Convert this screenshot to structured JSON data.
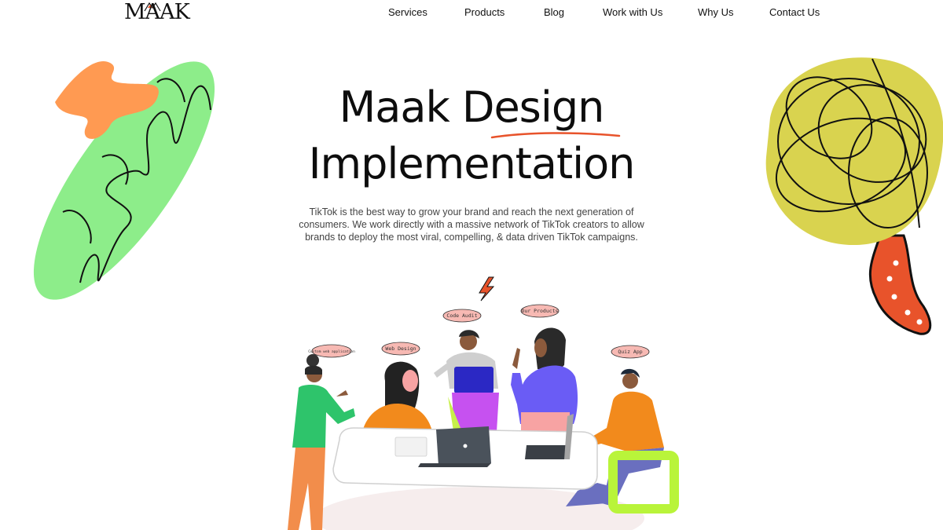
{
  "brand": {
    "logo_text": "MAAK"
  },
  "nav": {
    "items": [
      {
        "label": "Services"
      },
      {
        "label": "Products"
      },
      {
        "label": "Blog"
      },
      {
        "label": "Work with Us"
      },
      {
        "label": "Why Us"
      },
      {
        "label": "Contact Us"
      }
    ]
  },
  "hero": {
    "title_line1": "Maak Design",
    "title_line2": "Implementation",
    "description": "TikTok is the best way to grow your brand and reach the next generation of consumers. We work directly with a massive network of TikTok creators to allow brands to deploy the most viral, compelling, & data driven TikTok campaigns."
  },
  "illustration": {
    "bubbles": [
      {
        "text": "Custom web application"
      },
      {
        "text": "Web Design"
      },
      {
        "text": "Code Audit"
      },
      {
        "text": "Our Products"
      },
      {
        "text": "Quiz App"
      }
    ]
  },
  "colors": {
    "green_blob": "#8ded8a",
    "orange_scribble": "#ff9a52",
    "yellow_blob": "#d9d34f",
    "red_tail": "#e8532b",
    "accent_underline": "#e8532b",
    "table": "#ffffff",
    "purple": "#6a5cf5",
    "green_shirt": "#2ec46b",
    "orange_shirt": "#f28a1c"
  }
}
